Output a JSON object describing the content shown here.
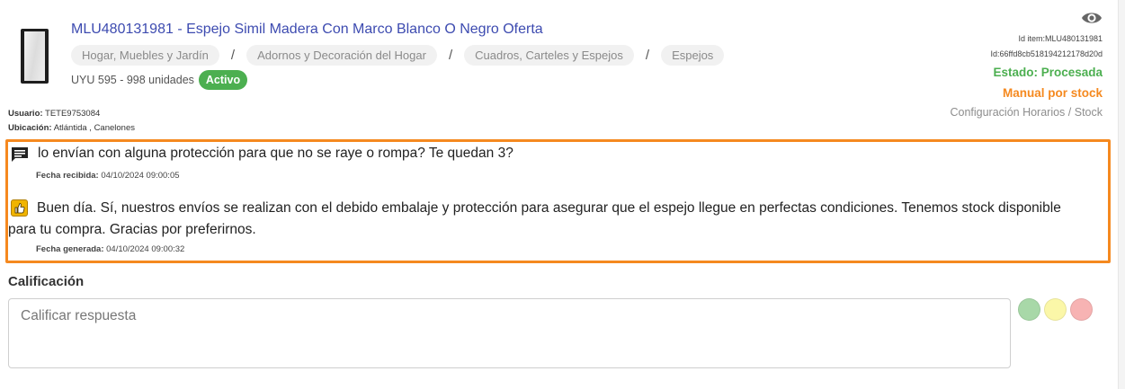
{
  "item": {
    "title": "MLU480131981 - Espejo Simil Madera Con Marco Blanco O Negro Oferta",
    "breadcrumbs": [
      "Hogar, Muebles y Jardín",
      "Adornos y Decoración del Hogar",
      "Cuadros, Carteles y Espejos",
      "Espejos"
    ],
    "separator": "/",
    "price": "UYU 595 - 998 unidades",
    "status_badge": "Activo",
    "usuario_label": "Usuario:",
    "usuario": "TETE9753084",
    "ubicacion_label": "Ubicación:",
    "ubicacion": "Atlántida , Canelones"
  },
  "right_panel": {
    "icon": "eye-icon",
    "id_item": "Id item:MLU480131981",
    "id": "Id:66ffd8cb518194212178d20d",
    "estado": "Estado: Procesada",
    "manual": "Manual por stock",
    "config": "Configuración Horarios / Stock"
  },
  "conversation": {
    "question": "lo envían con alguna protección para que no se raye o rompa? Te quedan 3?",
    "received_label": "Fecha recibida:",
    "received_date": "04/10/2024 09:00:05",
    "answer": "Buen día. Sí, nuestros envíos se realizan con el debido embalaje y protección para asegurar que el espejo llegue en perfectas condiciones. Tenemos stock disponible para tu compra. Gracias por preferirnos.",
    "generated_label": "Fecha generada:",
    "generated_date": "04/10/2024 09:00:32"
  },
  "rating": {
    "label": "Calificación",
    "placeholder": "Calificar respuesta",
    "options": [
      {
        "name": "green",
        "color": "#a8d8a8"
      },
      {
        "name": "yellow",
        "color": "#fbf7a8"
      },
      {
        "name": "red",
        "color": "#f7b3b3"
      }
    ]
  },
  "colors": {
    "title": "#3d4bb0",
    "accent_orange": "#f5891f",
    "success_green": "#4caf50"
  }
}
